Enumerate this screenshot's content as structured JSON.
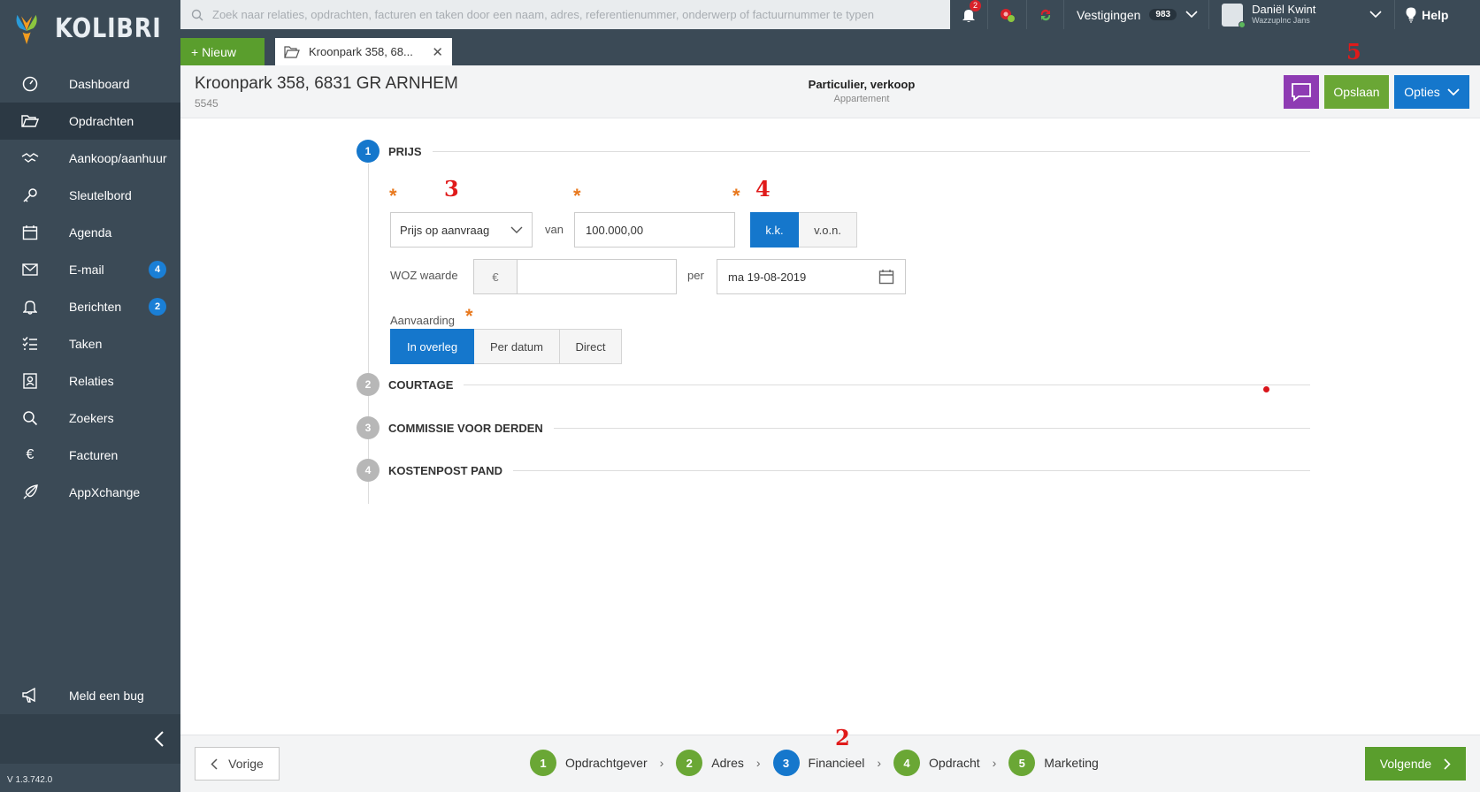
{
  "app": {
    "name": "KOLIBRI",
    "version": "V 1.3.742.0"
  },
  "sidebar": {
    "items": [
      {
        "label": "Dashboard",
        "icon": "gauge-icon"
      },
      {
        "label": "Opdrachten",
        "icon": "folder-open-icon",
        "active": true
      },
      {
        "label": "Aankoop/aanhuur",
        "icon": "handshake-icon"
      },
      {
        "label": "Sleutelbord",
        "icon": "key-icon"
      },
      {
        "label": "Agenda",
        "icon": "calendar-icon"
      },
      {
        "label": "E-mail",
        "icon": "envelope-icon",
        "badge": "4"
      },
      {
        "label": "Berichten",
        "icon": "bell-icon",
        "badge": "2"
      },
      {
        "label": "Taken",
        "icon": "checklist-icon"
      },
      {
        "label": "Relaties",
        "icon": "contact-card-icon"
      },
      {
        "label": "Zoekers",
        "icon": "search-icon"
      },
      {
        "label": "Facturen",
        "icon": "euro-icon"
      },
      {
        "label": "AppXchange",
        "icon": "rocket-icon"
      }
    ],
    "bug_label": "Meld een bug"
  },
  "topbar": {
    "search_placeholder": "Zoek naar relaties, opdrachten, facturen en taken door een naam, adres, referentienummer, onderwerp of factuurnummer te typen",
    "notification_count": "2",
    "vestigingen_label": "Vestigingen",
    "vestigingen_count": "983",
    "user_name": "Daniël Kwint",
    "user_sub": "WazzupInc Jans",
    "help_label": "Help",
    "new_button": "+ Nieuw",
    "doc_tab": "Kroonpark 358, 68..."
  },
  "header": {
    "address": "Kroonpark 358, 6831 GR ARNHEM",
    "ref": "5545",
    "type_main": "Particulier, verkoop",
    "type_sub": "Appartement",
    "save_label": "Opslaan",
    "options_label": "Opties"
  },
  "annotations": {
    "a2": "2",
    "a3": "3",
    "a4": "4",
    "a5": "5"
  },
  "sections": [
    {
      "num": "1",
      "title": "PRIJS",
      "active": true
    },
    {
      "num": "2",
      "title": "COURTAGE"
    },
    {
      "num": "3",
      "title": "COMMISSIE VOOR DERDEN"
    },
    {
      "num": "4",
      "title": "KOSTENPOST PAND"
    }
  ],
  "price": {
    "condition": "Prijs op aanvraag",
    "van_label": "van",
    "amount": "100.000,00",
    "kk": "k.k.",
    "von": "v.o.n.",
    "woz_label": "WOZ waarde",
    "currency": "€",
    "woz_value": "",
    "per_label": "per",
    "date": "ma 19-08-2019",
    "aanvaarding_label": "Aanvaarding",
    "acceptance_options": [
      "In overleg",
      "Per datum",
      "Direct"
    ],
    "required_mark": "*"
  },
  "footer": {
    "prev": "Vorige",
    "next": "Volgende",
    "steps": [
      {
        "num": "1",
        "label": "Opdrachtgever"
      },
      {
        "num": "2",
        "label": "Adres"
      },
      {
        "num": "3",
        "label": "Financieel",
        "current": true
      },
      {
        "num": "4",
        "label": "Opdracht"
      },
      {
        "num": "5",
        "label": "Marketing"
      }
    ]
  },
  "colors": {
    "sidebar": "#3b4a56",
    "primary": "#1577cc",
    "green": "#5a9e2d",
    "purple": "#8e3bb3",
    "required": "#e8781d"
  }
}
